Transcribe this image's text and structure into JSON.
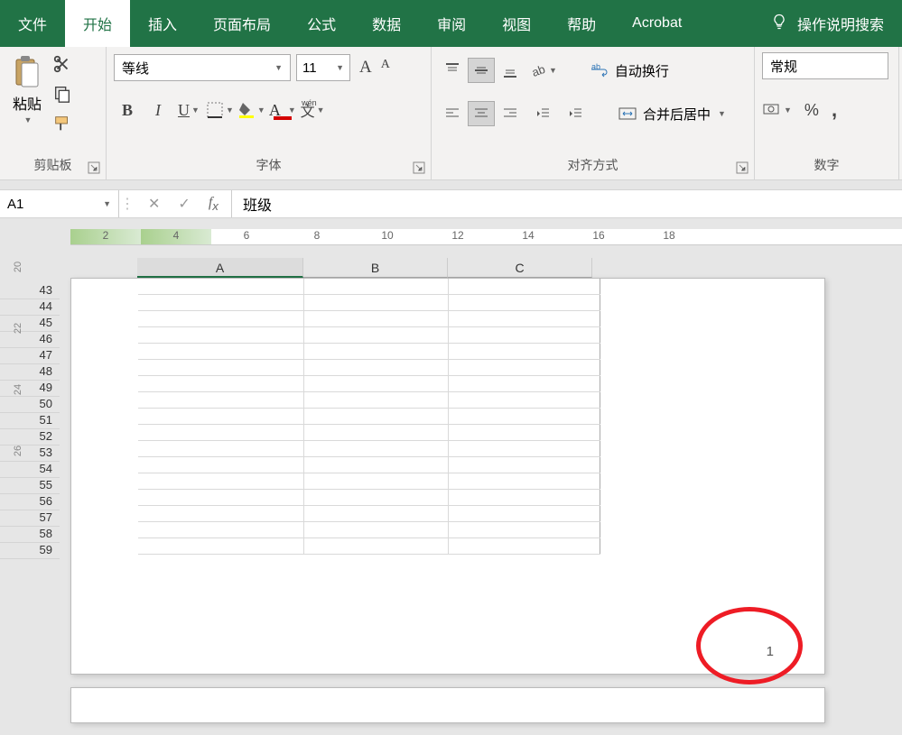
{
  "tabs": {
    "file": "文件",
    "home": "开始",
    "insert": "插入",
    "page_layout": "页面布局",
    "formulas": "公式",
    "data": "数据",
    "review": "审阅",
    "view": "视图",
    "help": "帮助",
    "acrobat": "Acrobat"
  },
  "tell_me": "操作说明搜索",
  "clipboard": {
    "paste": "粘贴",
    "label": "剪贴板"
  },
  "font": {
    "name": "等线",
    "size": "11",
    "bold": "B",
    "italic": "I",
    "underline": "U",
    "phonetic": "wén",
    "phonetic_char": "文",
    "aa_large": "A",
    "aa_small": "A",
    "label": "字体"
  },
  "align": {
    "wrap": "自动换行",
    "merge": "合并后居中",
    "label": "对齐方式"
  },
  "number": {
    "format": "常规",
    "percent": "%",
    "comma": ",",
    "label": "数字"
  },
  "name_box": "A1",
  "formula_value": "班级",
  "ruler_marks": [
    "2",
    "4",
    "6",
    "8",
    "10",
    "12",
    "14",
    "16",
    "18"
  ],
  "left_ruler_marks": [
    "20",
    "22",
    "24",
    "26"
  ],
  "columns": [
    "A",
    "B",
    "C"
  ],
  "rows": [
    "43",
    "44",
    "45",
    "46",
    "47",
    "48",
    "49",
    "50",
    "51",
    "52",
    "53",
    "54",
    "55",
    "56",
    "57",
    "58",
    "59"
  ],
  "page_number": "1"
}
